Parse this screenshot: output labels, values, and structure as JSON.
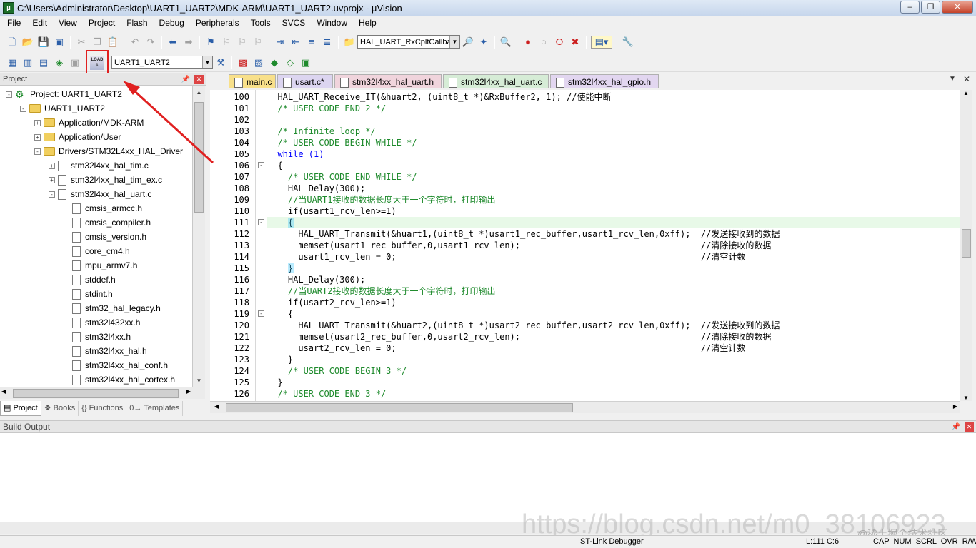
{
  "window": {
    "title": "C:\\Users\\Administrator\\Desktop\\UART1_UART2\\MDK-ARM\\UART1_UART2.uvprojx - µVision",
    "app_icon_text": "μ"
  },
  "menu": [
    "File",
    "Edit",
    "View",
    "Project",
    "Flash",
    "Debug",
    "Peripherals",
    "Tools",
    "SVCS",
    "Window",
    "Help"
  ],
  "toolbar": {
    "function_combo": "HAL_UART_RxCpltCallbac",
    "target_combo": "UART1_UART2",
    "load_button_label": "LOAD"
  },
  "project_panel": {
    "header": "Project",
    "tree": [
      {
        "label": "Project: UART1_UART2",
        "indent": 0,
        "type": "project",
        "exp": "-"
      },
      {
        "label": "UART1_UART2",
        "indent": 1,
        "type": "folder",
        "exp": "-"
      },
      {
        "label": "Application/MDK-ARM",
        "indent": 2,
        "type": "folder",
        "exp": "+"
      },
      {
        "label": "Application/User",
        "indent": 2,
        "type": "folder",
        "exp": "+"
      },
      {
        "label": "Drivers/STM32L4xx_HAL_Driver",
        "indent": 2,
        "type": "folder",
        "exp": "-"
      },
      {
        "label": "stm32l4xx_hal_tim.c",
        "indent": 3,
        "type": "file",
        "exp": "+"
      },
      {
        "label": "stm32l4xx_hal_tim_ex.c",
        "indent": 3,
        "type": "file",
        "exp": "+"
      },
      {
        "label": "stm32l4xx_hal_uart.c",
        "indent": 3,
        "type": "file",
        "exp": "-"
      },
      {
        "label": "cmsis_armcc.h",
        "indent": 4,
        "type": "file",
        "exp": ""
      },
      {
        "label": "cmsis_compiler.h",
        "indent": 4,
        "type": "file",
        "exp": ""
      },
      {
        "label": "cmsis_version.h",
        "indent": 4,
        "type": "file",
        "exp": ""
      },
      {
        "label": "core_cm4.h",
        "indent": 4,
        "type": "file",
        "exp": ""
      },
      {
        "label": "mpu_armv7.h",
        "indent": 4,
        "type": "file",
        "exp": ""
      },
      {
        "label": "stddef.h",
        "indent": 4,
        "type": "file",
        "exp": ""
      },
      {
        "label": "stdint.h",
        "indent": 4,
        "type": "file",
        "exp": ""
      },
      {
        "label": "stm32_hal_legacy.h",
        "indent": 4,
        "type": "file",
        "exp": ""
      },
      {
        "label": "stm32l432xx.h",
        "indent": 4,
        "type": "file",
        "exp": ""
      },
      {
        "label": "stm32l4xx.h",
        "indent": 4,
        "type": "file",
        "exp": ""
      },
      {
        "label": "stm32l4xx_hal.h",
        "indent": 4,
        "type": "file",
        "exp": ""
      },
      {
        "label": "stm32l4xx_hal_conf.h",
        "indent": 4,
        "type": "file",
        "exp": ""
      },
      {
        "label": "stm32l4xx_hal_cortex.h",
        "indent": 4,
        "type": "file",
        "exp": ""
      }
    ],
    "tabs": [
      "Project",
      "Books",
      "{} Functions",
      "0→ Templates"
    ]
  },
  "editor_tabs": [
    {
      "label": "main.c",
      "style": "active"
    },
    {
      "label": "usart.c*",
      "style": "t-user"
    },
    {
      "label": "stm32l4xx_hal_uart.h",
      "style": "t-pink"
    },
    {
      "label": "stm32l4xx_hal_uart.c",
      "style": "t-green"
    },
    {
      "label": "stm32l4xx_hal_gpio.h",
      "style": "t-lav"
    }
  ],
  "code_lines": [
    {
      "n": "100",
      "text": "  HAL_UART_Receive_IT(&huart2, (uint8_t *)&RxBuffer2, 1); //使能中断",
      "cls": "",
      "fold": ""
    },
    {
      "n": "101",
      "text": "  /* USER CODE END 2 */",
      "cls": "comment",
      "fold": ""
    },
    {
      "n": "102",
      "text": "",
      "cls": "",
      "fold": ""
    },
    {
      "n": "103",
      "text": "  /* Infinite loop */",
      "cls": "comment",
      "fold": ""
    },
    {
      "n": "104",
      "text": "  /* USER CODE BEGIN WHILE */",
      "cls": "comment",
      "fold": ""
    },
    {
      "n": "105",
      "text": "  while (1)",
      "cls": "kw",
      "fold": ""
    },
    {
      "n": "106",
      "text": "  {",
      "cls": "",
      "fold": "-"
    },
    {
      "n": "107",
      "text": "    /* USER CODE END WHILE */",
      "cls": "comment",
      "fold": ""
    },
    {
      "n": "108",
      "text": "    HAL_Delay(300);",
      "cls": "",
      "fold": ""
    },
    {
      "n": "109",
      "text": "    //当UART1接收的数据长度大于一个字符时，打印输出",
      "cls": "comment",
      "fold": ""
    },
    {
      "n": "110",
      "text": "    if(usart1_rcv_len>=1)",
      "cls": "",
      "fold": ""
    },
    {
      "n": "111",
      "text": "    {",
      "cls": "hl",
      "fold": "-"
    },
    {
      "n": "112",
      "text": "      HAL_UART_Transmit(&huart1,(uint8_t *)usart1_rec_buffer,usart1_rcv_len,0xff);  //发送接收到的数据",
      "cls": "",
      "fold": ""
    },
    {
      "n": "113",
      "text": "      memset(usart1_rec_buffer,0,usart1_rcv_len);                                   //清除接收的数据",
      "cls": "",
      "fold": ""
    },
    {
      "n": "114",
      "text": "      usart1_rcv_len = 0;                                                           //清空计数",
      "cls": "",
      "fold": ""
    },
    {
      "n": "115",
      "text": "    }",
      "cls": "",
      "fold": ""
    },
    {
      "n": "116",
      "text": "    HAL_Delay(300);",
      "cls": "",
      "fold": ""
    },
    {
      "n": "117",
      "text": "    //当UART2接收的数据长度大于一个字符时，打印输出",
      "cls": "comment",
      "fold": ""
    },
    {
      "n": "118",
      "text": "    if(usart2_rcv_len>=1)",
      "cls": "",
      "fold": ""
    },
    {
      "n": "119",
      "text": "    {",
      "cls": "",
      "fold": "-"
    },
    {
      "n": "120",
      "text": "      HAL_UART_Transmit(&huart2,(uint8_t *)usart2_rec_buffer,usart2_rcv_len,0xff);  //发送接收到的数据",
      "cls": "",
      "fold": ""
    },
    {
      "n": "121",
      "text": "      memset(usart2_rec_buffer,0,usart2_rcv_len);                                   //清除接收的数据",
      "cls": "",
      "fold": ""
    },
    {
      "n": "122",
      "text": "      usart2_rcv_len = 0;                                                           //清空计数",
      "cls": "",
      "fold": ""
    },
    {
      "n": "123",
      "text": "    }",
      "cls": "",
      "fold": ""
    },
    {
      "n": "124",
      "text": "    /* USER CODE BEGIN 3 */",
      "cls": "comment",
      "fold": ""
    },
    {
      "n": "125",
      "text": "  }",
      "cls": "",
      "fold": ""
    },
    {
      "n": "126",
      "text": "  /* USER CODE END 3 */",
      "cls": "comment",
      "fold": ""
    }
  ],
  "build_output": {
    "header": "Build Output"
  },
  "statusbar": {
    "debugger": "ST-Link Debugger",
    "position": "L:111 C:6",
    "flags": "CAP  NUM  SCRL  OVR  R/W"
  },
  "watermark": {
    "url": "https://blog.csdn.net/m0_38106923",
    "community": "@稀土掘金技术社区"
  },
  "colors": {
    "annotation": "#e02020",
    "comment": "#1e8a2c",
    "keyword": "#0000ff",
    "active_line": "#e8f9e8"
  }
}
